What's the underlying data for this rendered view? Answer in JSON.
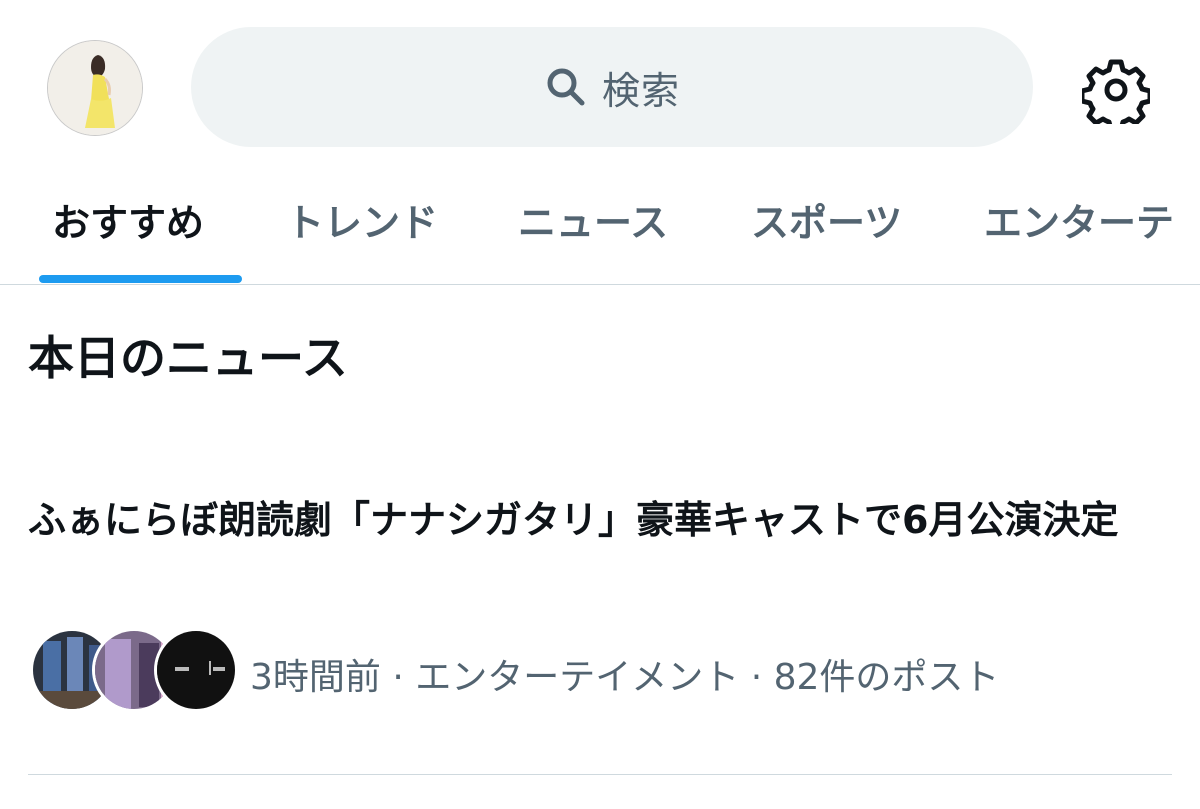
{
  "header": {
    "search_placeholder": "検索",
    "icons": {
      "search": "search-icon",
      "settings": "gear-icon"
    }
  },
  "tabs": [
    {
      "label": "おすすめ",
      "active": true
    },
    {
      "label": "トレンド",
      "active": false
    },
    {
      "label": "ニュース",
      "active": false
    },
    {
      "label": "スポーツ",
      "active": false
    },
    {
      "label": "エンターテ",
      "active": false
    }
  ],
  "section": {
    "title": "本日のニュース"
  },
  "news_item": {
    "headline": "ふぁにらぼ朗読劇「ナナシガタリ」豪華キャストで6月公演決定",
    "time": "3時間前",
    "category": "エンターテイメント",
    "post_count": "82件のポスト",
    "separator": " · "
  },
  "colors": {
    "accent": "#1d9bf0",
    "text_primary": "#0f1419",
    "text_secondary": "#536471",
    "search_bg": "#eff3f4",
    "divider": "#cfd9de"
  }
}
